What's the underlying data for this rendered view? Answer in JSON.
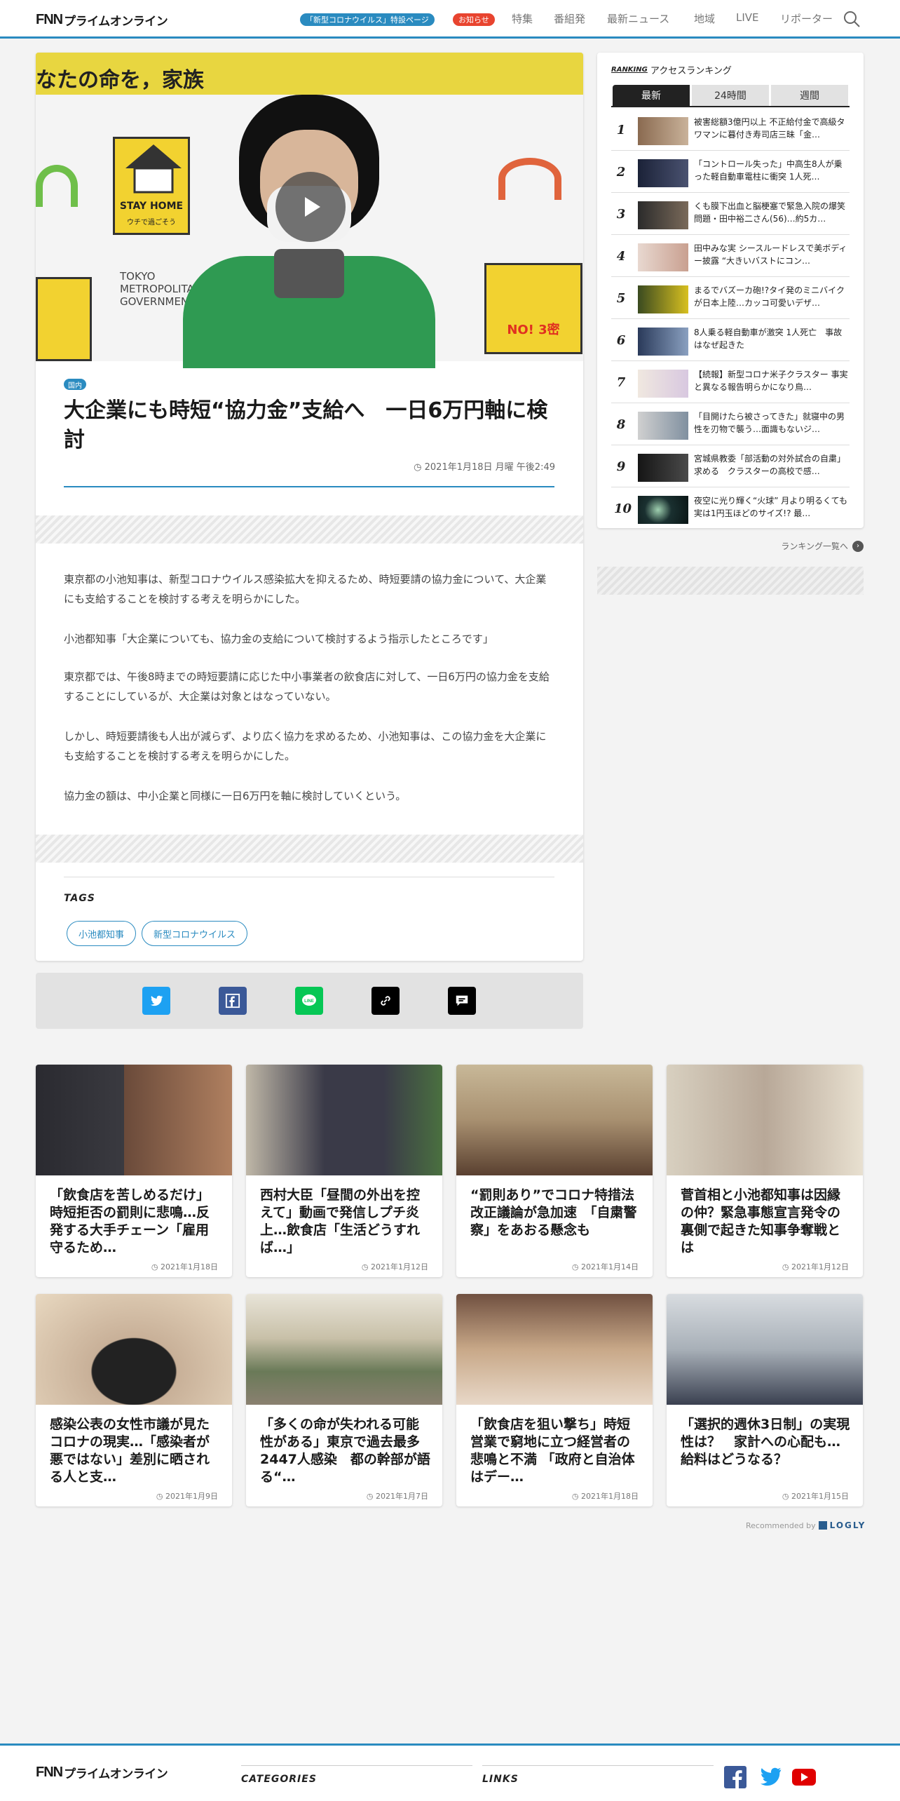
{
  "header": {
    "logo_mark": "FNN",
    "logo_text": "プライムオンライン",
    "corona_pill": "「新型コロナウイルス」特設ページ",
    "notice_pill": "お知らせ",
    "nav": [
      "特集",
      "番組発",
      "最新ニュース",
      "地域",
      "LIVE",
      "リポーター"
    ]
  },
  "article": {
    "category": "国内",
    "title": "大企業にも時短“協力金”支給へ　一日6万円軸に検討",
    "date": "2021年1月18日 月曜 午後2:49",
    "paragraphs": [
      "東京都の小池知事は、新型コロナウイルス感染拡大を抑えるため、時短要請の協力金について、大企業にも支給することを検討する考えを明らかにした。",
      "小池都知事「大企業についても、協力金の支給について検討するよう指示したところです」",
      "東京都では、午後8時までの時短要請に応じた中小事業者の飲食店に対して、一日6万円の協力金を支給することにしているが、大企業は対象とはなっていない。",
      "しかし、時短要請後も人出が減らず、より広く協力を求めるため、小池知事は、この協力金を大企業にも支給することを検討する考えを明らかにした。",
      "協力金の額は、中小企業と同様に一日6万円を軸に検討していくという。"
    ],
    "tags_label": "TAGS",
    "tags": [
      "小池都知事",
      "新型コロナウイルス"
    ]
  },
  "ranking": {
    "label_small": "RANKING",
    "label": "アクセスランキング",
    "tabs": [
      "最新",
      "24時間",
      "週間"
    ],
    "more": "ランキング一覧へ",
    "items": [
      {
        "rank": "1",
        "text": "被害総額3億円以上 不正給付金で高級タワマンに暮付き寿司店三昧「金…"
      },
      {
        "rank": "2",
        "text": "「コントロール失った」中高生8人が乗った軽自動車電柱に衝突 1人死…"
      },
      {
        "rank": "3",
        "text": "くも膜下出血と脳梗塞で緊急入院の爆笑問題・田中裕二さん(56)…約5カ…"
      },
      {
        "rank": "4",
        "text": "田中みな実 シースルードレスで美ボディー披露 “大きいバストにコン…"
      },
      {
        "rank": "5",
        "text": "まるでバズーカ砲!?タイ発のミニバイクが日本上陸…カッコ可愛いデザ…"
      },
      {
        "rank": "6",
        "text": "8人乗る軽自動車が激突 1人死亡　事故はなぜ起きた"
      },
      {
        "rank": "7",
        "text": "【続報】新型コロナ米子クラスター 事実と異なる報告明らかになり鳥…"
      },
      {
        "rank": "8",
        "text": "「目開けたら被さってきた」就寝中の男性を刃物で襲う…面識もないジ…"
      },
      {
        "rank": "9",
        "text": "宮城県教委「部活動の対外試合の自粛」求める　クラスターの高校で感…"
      },
      {
        "rank": "10",
        "text": "夜空に光り輝く“火球” 月より明るくても実は1円玉ほどのサイズ!? 最…"
      }
    ]
  },
  "recommend": [
    {
      "title": "「飲食店を苦しめるだけ」時短拒否の罰則に悲鳴…反発する大手チェーン「雇用守るため…",
      "date": "2021年1月18日"
    },
    {
      "title": "西村大臣「昼間の外出を控えて」動画で発信しプチ炎上…飲食店「生活どうすれば…」",
      "date": "2021年1月12日"
    },
    {
      "title": "“罰則あり”でコロナ特措法改正議論が急加速　「自粛警察」をあおる懸念も",
      "date": "2021年1月14日"
    },
    {
      "title": "菅首相と小池都知事は因縁の仲？緊急事態宣言発令の裏側で起きた知事争奪戦とは",
      "date": "2021年1月12日"
    },
    {
      "title": "感染公表の女性市議が見たコロナの現実…「感染者が悪ではない」差別に晒される人と支…",
      "date": "2021年1月9日"
    },
    {
      "title": "「多くの命が失われる可能性がある」東京で過去最多2447人感染　都の幹部が語る“…",
      "date": "2021年1月7日"
    },
    {
      "title": "「飲食店を狙い撃ち」時短営業で窮地に立つ経営者の悲鳴と不満 「政府と自治体はデー…",
      "date": "2021年1月18日"
    },
    {
      "title": "「選択的週休3日制」の実現性は？　家計への心配も…給料はどうなる？",
      "date": "2021年1月15日"
    }
  ],
  "hero_text": {
    "banner": "なたの命を，家族",
    "stay_home": "STAY HOME",
    "stay_sub": "ウチで過ごそう",
    "tokyo": "TOKYO\nMETROPOLITAN\nGOVERNMENT",
    "no3": "NO! 3密"
  },
  "logly": {
    "prefix": "Recommended by",
    "brand": "LOGLY"
  },
  "footer": {
    "categories": "CATEGORIES",
    "links": "LINKS"
  },
  "colors": {
    "accent": "#2a8bc0",
    "notice": "#e8442f",
    "twitter": "#1da1f2",
    "facebook": "#3b5998",
    "line": "#06c755",
    "youtube": "#e00000"
  }
}
